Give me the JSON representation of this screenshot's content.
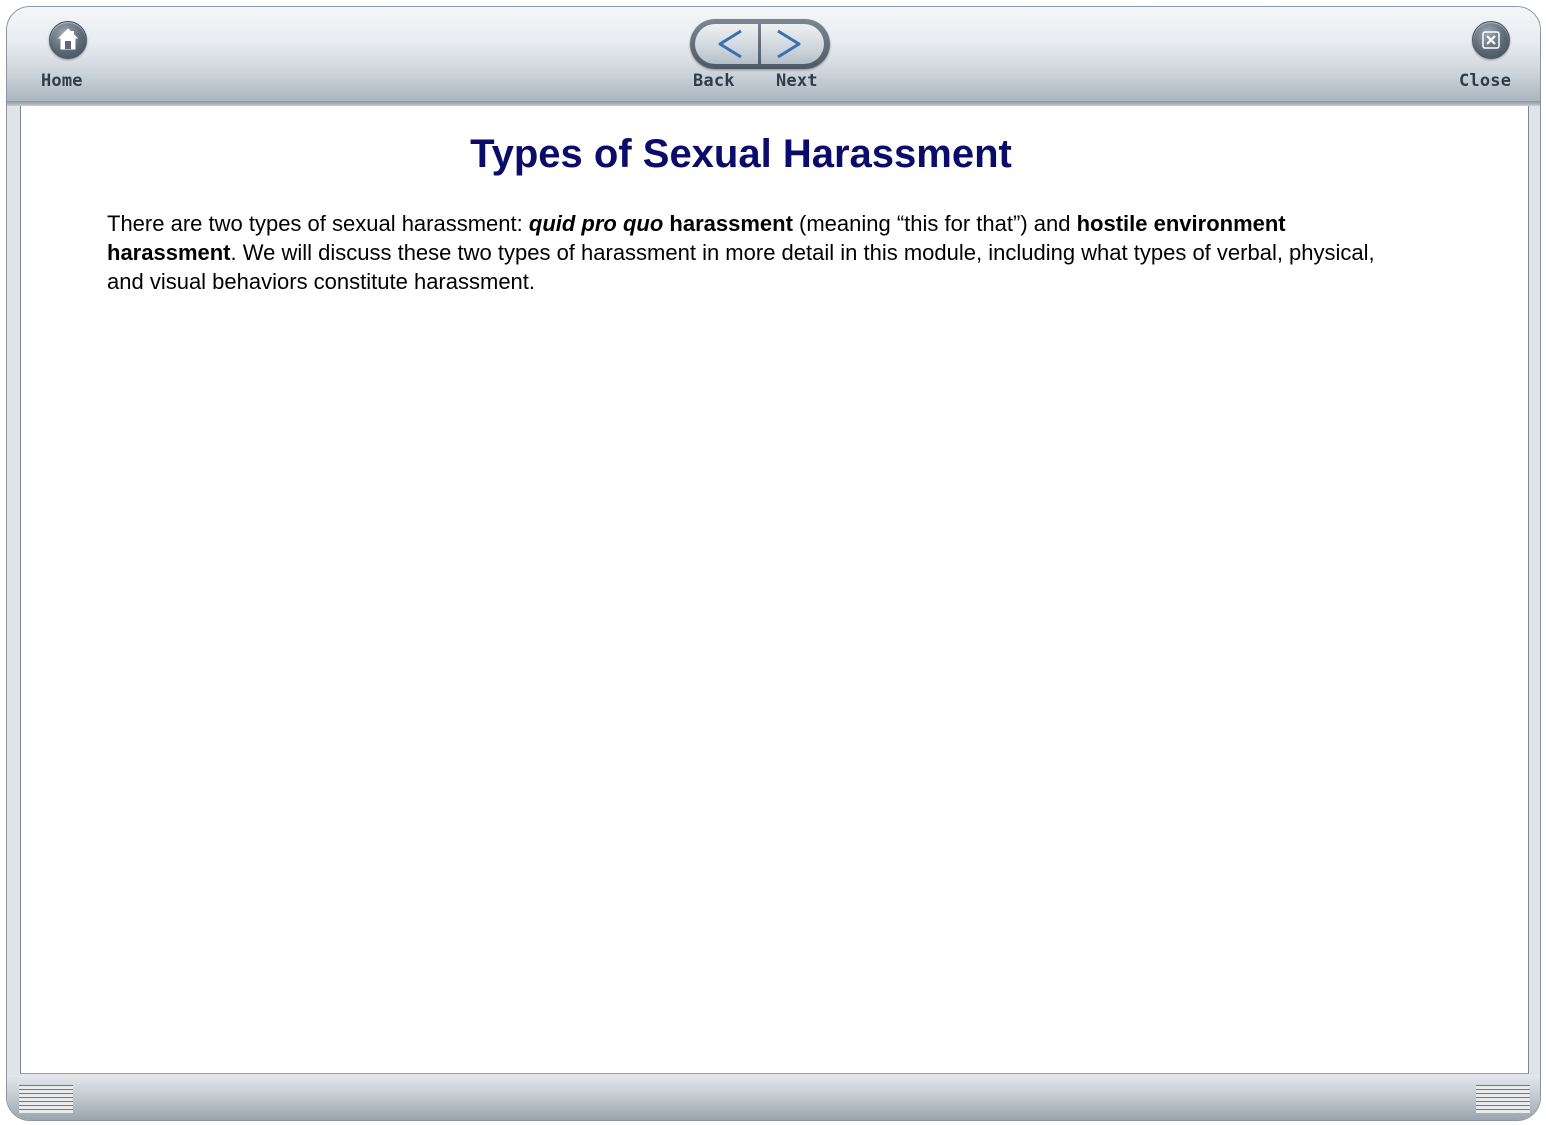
{
  "toolbar": {
    "home_label": "Home",
    "back_label": "Back",
    "next_label": "Next",
    "close_label": "Close"
  },
  "content": {
    "title": "Types of Sexual Harassment",
    "paragraph": {
      "t1": "There are two types of sexual harassment: ",
      "t2": "quid pro quo",
      "t3": " harassment",
      "t4": " (meaning “this for that”) and ",
      "t5": "hostile environment harassment",
      "t6": ". We will discuss these two types of harassment in more detail in this module, including what types of verbal, physical, and visual behaviors constitute harassment."
    }
  },
  "colors": {
    "title": "#0b0b6a",
    "toolbar_label": "#2f3e4c"
  },
  "icons": {
    "home": "home-icon",
    "back": "back-arrow-icon",
    "next": "next-arrow-icon",
    "close": "close-icon",
    "resize": "resize-grip-icon"
  }
}
